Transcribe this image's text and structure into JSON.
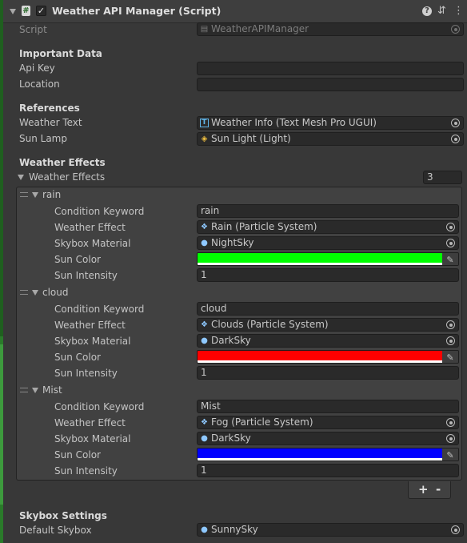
{
  "component": {
    "title": "Weather API Manager (Script)",
    "enabled": true
  },
  "script_row": {
    "label": "Script",
    "value": "WeatherAPIManager"
  },
  "important_data": {
    "header": "Important Data",
    "api_key_label": "Api Key",
    "api_key_value": "",
    "location_label": "Location",
    "location_value": ""
  },
  "references": {
    "header": "References",
    "weather_text_label": "Weather Text",
    "weather_text_value": "Weather Info (Text Mesh Pro UGUI)",
    "sun_lamp_label": "Sun Lamp",
    "sun_lamp_value": "Sun Light (Light)"
  },
  "weather_effects": {
    "header": "Weather Effects",
    "foldout_label": "Weather Effects",
    "count": "3",
    "field_labels": {
      "keyword": "Condition Keyword",
      "effect": "Weather Effect",
      "skybox": "Skybox Material",
      "color": "Sun Color",
      "intensity": "Sun Intensity"
    },
    "items": [
      {
        "name": "rain",
        "keyword": "rain",
        "effect": "Rain (Particle System)",
        "skybox": "NightSky",
        "sun_color": "#00ff00",
        "intensity": "1"
      },
      {
        "name": "cloud",
        "keyword": "cloud",
        "effect": "Clouds (Particle System)",
        "skybox": "DarkSky",
        "sun_color": "#ff0000",
        "intensity": "1"
      },
      {
        "name": "Mist",
        "keyword": "Mist",
        "effect": "Fog (Particle System)",
        "skybox": "DarkSky",
        "sun_color": "#0000ff",
        "intensity": "1"
      }
    ],
    "add_label": "+",
    "remove_label": "-"
  },
  "skybox_settings": {
    "header": "Skybox Settings",
    "default_label": "Default Skybox",
    "default_value": "SunnySky"
  },
  "icons": {
    "script": "script-icon",
    "text": "text-mesh-pro-icon",
    "light": "light-icon",
    "particle": "particle-system-icon",
    "material": "material-icon",
    "help": "help-icon",
    "settings": "presets-icon",
    "menu": "menu-icon",
    "eyedropper": "eyedropper-icon"
  },
  "colors": {
    "background": "#383838",
    "field": "#2a2a2a",
    "text": "#c4c4c4"
  }
}
